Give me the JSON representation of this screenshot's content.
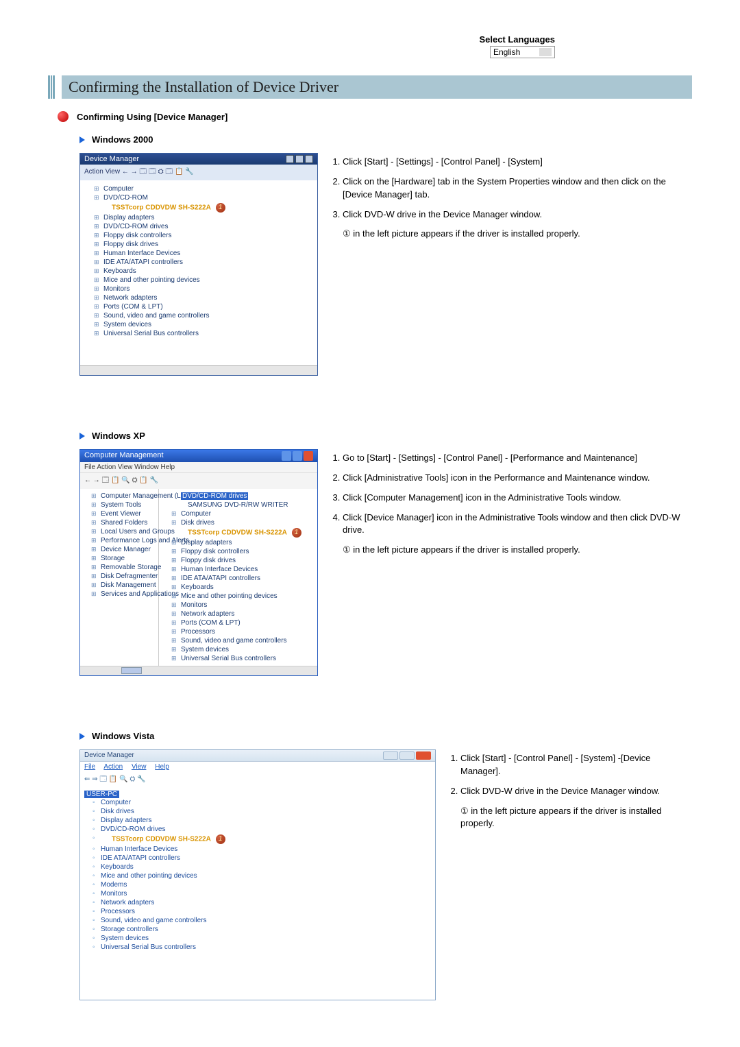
{
  "lang": {
    "label": "Select Languages",
    "current": "English"
  },
  "title": "Confirming the Installation of Device Driver",
  "section_title": "Confirming Using [Device Manager]",
  "markers": {
    "one": "1"
  },
  "w2000": {
    "heading": "Windows 2000",
    "window_title": "Device Manager",
    "toolbar": "Action  View   ← →  🗔 🗔  ⛭ 🗔  📋  🔧",
    "tree": {
      "root": "",
      "items": [
        "Computer",
        "DVD/CD-ROM"
      ],
      "highlight": "TSSTcorp CDDVDW SH-S222A",
      "items2": [
        "Display adapters",
        "DVD/CD-ROM drives",
        "Floppy disk controllers",
        "Floppy disk drives",
        "Human Interface Devices",
        "IDE ATA/ATAPI controllers",
        "Keyboards",
        "Mice and other pointing devices",
        "Monitors",
        "Network adapters",
        "Ports (COM & LPT)",
        "Sound, video and game controllers",
        "System devices",
        "Universal Serial Bus controllers"
      ]
    },
    "steps": [
      "Click [Start] - [Settings] - [Control Panel] - [System]",
      "Click on the [Hardware] tab in the System Properties window and then click on the [Device Manager] tab.",
      "Click DVD-W drive in the Device Manager window."
    ],
    "tail": "① in the left picture appears if the driver is installed properly."
  },
  "wxp": {
    "heading": "Windows XP",
    "window_title": "Computer Management",
    "menubar": "File  Action  View  Window  Help",
    "toolbar": "← →  🗔 📋 🔍 ⛭ 📋  🔧",
    "left_tree": [
      "Computer Management (Local)",
      "System Tools",
      "Event Viewer",
      "Shared Folders",
      "Local Users and Groups",
      "Performance Logs and Alerts",
      "Device Manager",
      "Storage",
      "Removable Storage",
      "Disk Defragmenter",
      "Disk Management",
      "Services and Applications"
    ],
    "right_tree_first": "DVD/CD-ROM drives",
    "right_tree_sub": "SAMSUNG DVD-R/RW WRITER",
    "right_tree_items1": [
      "Computer",
      "Disk drives"
    ],
    "right_highlight": "TSSTcorp CDDVDW SH-S222A",
    "right_tree_items2": [
      "Display adapters",
      "Floppy disk controllers",
      "Floppy disk drives",
      "Human Interface Devices",
      "IDE ATA/ATAPI controllers",
      "Keyboards",
      "Mice and other pointing devices",
      "Monitors",
      "Network adapters",
      "Ports (COM & LPT)",
      "Processors",
      "Sound, video and game controllers",
      "System devices",
      "Universal Serial Bus controllers"
    ],
    "steps": [
      "Go to [Start] - [Settings] - [Control Panel] - [Performance and Maintenance]",
      "Click [Administrative Tools] icon in the Performance and Maintenance window.",
      "Click [Computer Management] icon in the Administrative Tools window.",
      "Click [Device Manager] icon in the Administrative Tools window and then click DVD-W drive."
    ],
    "tail": "① in the left picture appears if the driver is installed properly."
  },
  "wvista": {
    "heading": "Windows Vista",
    "window_title": "Device Manager",
    "menu": {
      "file": "File",
      "action": "Action",
      "view": "View",
      "help": "Help"
    },
    "toolbar": "⇐ ⇒  🗔 📋  🔍 ⛭  🔧",
    "root": "USER-PC",
    "tree1": [
      "Computer",
      "Disk drives",
      "Display adapters",
      "DVD/CD-ROM drives"
    ],
    "highlight": "TSSTcorp CDDVDW SH-S222A",
    "tree2": [
      "Human Interface Devices",
      "IDE ATA/ATAPI controllers",
      "Keyboards",
      "Mice and other pointing devices",
      "Modems",
      "Monitors",
      "Network adapters",
      "Processors",
      "Sound, video and game controllers",
      "Storage controllers",
      "System devices",
      "Universal Serial Bus controllers"
    ],
    "steps": [
      "Click [Start] - [Control Panel] - [System] -[Device Manager].",
      "Click DVD-W drive in the Device Manager window."
    ],
    "tail": "① in the left picture appears if the driver is installed properly."
  }
}
